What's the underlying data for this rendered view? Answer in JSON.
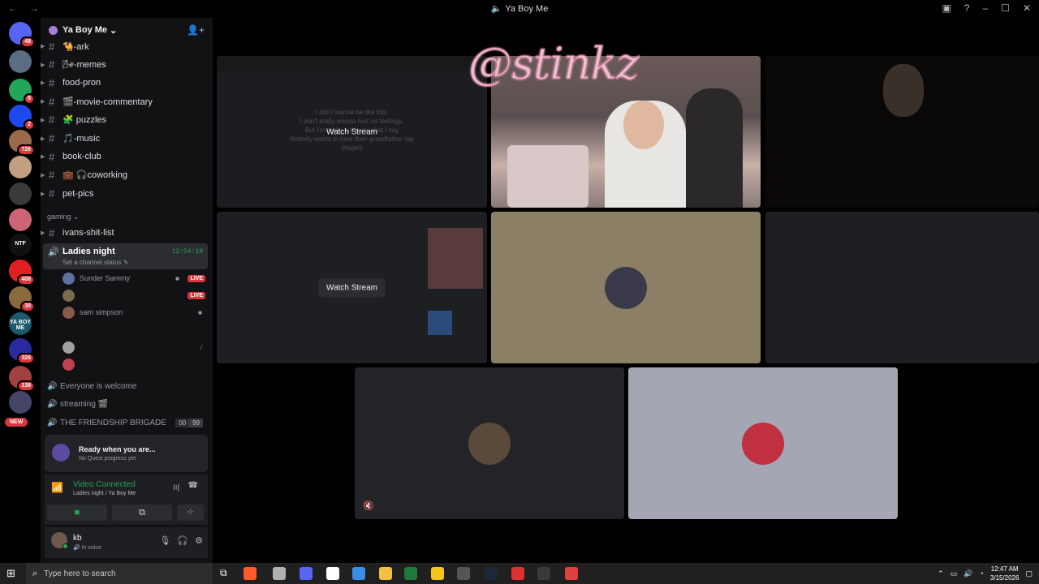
{
  "window": {
    "title": "Ya Boy Me",
    "back": "←",
    "forward": "→",
    "inbox_icon": "▣",
    "help_icon": "?",
    "minimize": "–",
    "maximize": "☐",
    "close": "✕"
  },
  "servers": [
    {
      "color": "#5865f2",
      "badge": "48"
    },
    {
      "color": "#5b6d82",
      "badge": ""
    },
    {
      "color": "#23a55a",
      "badge": "8"
    },
    {
      "color": "#1f49f0",
      "badge": "2"
    },
    {
      "color": "#9a6a4a",
      "badge": "726"
    },
    {
      "color": "#c0a080",
      "badge": ""
    },
    {
      "color": "#3a3a3a",
      "badge": ""
    },
    {
      "color": "#cc6677",
      "badge": ""
    },
    {
      "color": "#111111",
      "badge": "",
      "text": "NTF"
    },
    {
      "color": "#e02020",
      "badge": "408"
    },
    {
      "color": "#8a6a3a",
      "badge": "30"
    },
    {
      "color": "#1a5a6a",
      "badge": "",
      "text": "YA BOY ME"
    },
    {
      "color": "#2a2aa0",
      "badge": "326"
    },
    {
      "color": "#a04040",
      "badge": "138"
    },
    {
      "color": "#444466",
      "badge": ""
    }
  ],
  "new_badge": "NEW",
  "guild": {
    "name": "Ya Boy Me",
    "chevron": "⌄",
    "invite_icon": "👤+"
  },
  "text_channels": [
    {
      "name": "🐪-ark"
    },
    {
      "name": "🌬-memes"
    },
    {
      "name": "food-pron"
    },
    {
      "name": "🎬-movie-commentary"
    },
    {
      "name": "🧩 puzzles"
    },
    {
      "name": "🎵-music"
    },
    {
      "name": "book-club"
    },
    {
      "name": "💼 🎧coworking"
    },
    {
      "name": "pet-pics"
    }
  ],
  "category": "gaming ⌄",
  "gaming_channel": "ivans-shit-list",
  "active_voice": {
    "name": "Ladies night",
    "status": "Set a channel status ✎",
    "time": "12:54:19"
  },
  "voice_users": [
    {
      "name": "Sunder Sammy",
      "live": "LIVE",
      "color": "#6070a0"
    },
    {
      "name": "",
      "live": "LIVE",
      "color": "#7a6a50"
    },
    {
      "name": "sam simpson",
      "live": "",
      "color": "#8a5a4a"
    },
    {
      "name": "",
      "live": "",
      "color": "#a0a0a0"
    },
    {
      "name": "",
      "live": "",
      "color": "#c04050"
    }
  ],
  "voice_channels": [
    {
      "name": "Everyone is welcome"
    },
    {
      "name": "streaming 🎬"
    },
    {
      "name": "THE FRIENDSHIP BRIGADE",
      "limit": [
        "00",
        "99"
      ]
    }
  ],
  "quest": {
    "title": "Ready when you are...",
    "subtitle": "No Quest progress yet"
  },
  "voice_connection": {
    "status": "Video Connected",
    "location": "Ladies night / Ya Boy Me"
  },
  "user": {
    "name": "kb",
    "status": "🔊 In voice"
  },
  "stage": {
    "overlay_text": "@stinkz",
    "watch_label": "Watch Stream",
    "lyrics": [
      "I don't wanna be like this,",
      "I don't really wanna hurt no feelings,",
      "But I'm really not sure what I say",
      "Nobody wants to hear their grandfather rap",
      "(Nope!)"
    ]
  },
  "taskbar": {
    "search_placeholder": "Type here to search",
    "time": "12:47 AM",
    "date": "3/15/2026"
  }
}
